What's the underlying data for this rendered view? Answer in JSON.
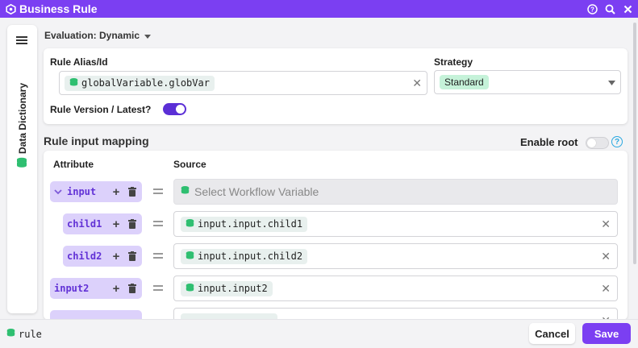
{
  "window": {
    "title": "Business Rule"
  },
  "sidebar": {
    "label": "Data Dictionary"
  },
  "evaluation": {
    "label": "Evaluation: Dynamic"
  },
  "rule": {
    "alias_label": "Rule Alias/Id",
    "alias_value": "globalVariable.globVar",
    "strategy_label": "Strategy",
    "strategy_value": "Standard",
    "version_label": "Rule Version / Latest?",
    "version_latest": true
  },
  "mapping": {
    "title": "Rule input mapping",
    "enable_root_label": "Enable root",
    "enable_root": false,
    "columns": {
      "attribute": "Attribute",
      "source": "Source"
    },
    "rows": [
      {
        "attribute": "input",
        "source": "",
        "placeholder": "Select Workflow Variable",
        "expanded": true
      },
      {
        "attribute": "child1",
        "source": "input.input.child1"
      },
      {
        "attribute": "child2",
        "source": "input.input.child2"
      },
      {
        "attribute": "input2",
        "source": "input.input2"
      }
    ]
  },
  "footer": {
    "context": "rule",
    "cancel_label": "Cancel",
    "save_label": "Save"
  },
  "colors": {
    "accent": "#7b3ff2",
    "chip_green": "#c5f2d9",
    "attr_bg": "#dcd1fb",
    "db_icon": "#2fbf71"
  }
}
